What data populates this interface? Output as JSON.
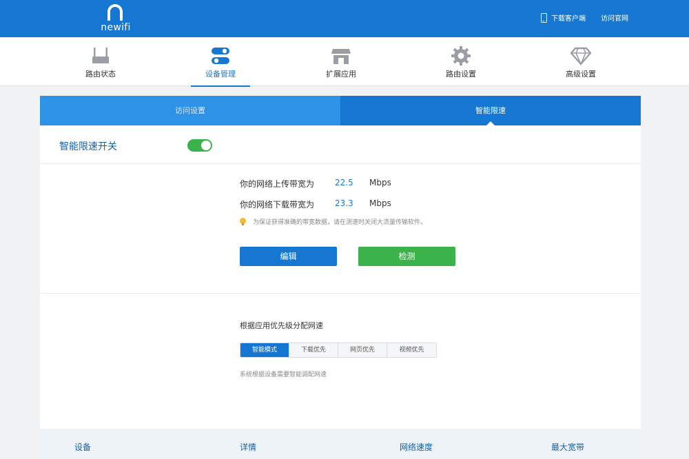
{
  "header": {
    "logo_text": "newifi",
    "download_client": "下载客户端",
    "visit_site": "访问官网"
  },
  "nav": {
    "items": [
      {
        "label": "路由状态",
        "icon": "router-icon"
      },
      {
        "label": "设备管理",
        "icon": "toggles-icon",
        "active": true
      },
      {
        "label": "扩展应用",
        "icon": "store-icon"
      },
      {
        "label": "路由设置",
        "icon": "gear-icon"
      },
      {
        "label": "高级设置",
        "icon": "diamond-icon"
      }
    ]
  },
  "tabs": [
    "访问设置",
    "智能限速"
  ],
  "smart_limit": {
    "switch_label": "智能限速开关",
    "enabled": true,
    "upload_label": "你的网络上传带宽为",
    "upload_value": "22.5",
    "download_label": "你的网络下载带宽为",
    "download_value": "23.3",
    "unit": "Mbps",
    "tip": "为保证获得准确的带宽数据，请在测速时关闭大流量传输软件。",
    "edit_button": "编辑",
    "detect_button": "检测"
  },
  "priority": {
    "title": "根据应用优先级分配网速",
    "options": [
      "智能模式",
      "下载优先",
      "网页优先",
      "视频优先"
    ],
    "selected": "智能模式",
    "hint": "系统根据设备需要智能调配网速"
  },
  "table": {
    "headers": [
      "设备",
      "详情",
      "网络速度",
      "最大宽带"
    ]
  },
  "colors": {
    "primary": "#1677d2",
    "success": "#3bb34a"
  }
}
